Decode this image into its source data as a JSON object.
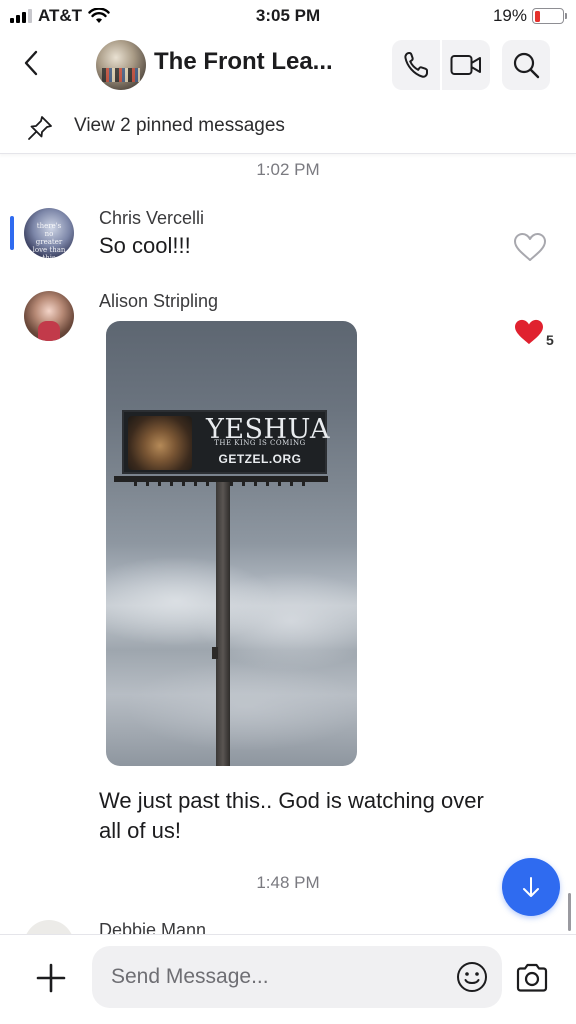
{
  "status_bar": {
    "carrier": "AT&T",
    "time": "3:05 PM",
    "battery_percent": "19%",
    "battery_level": 0.19,
    "icons": [
      "signal-icon",
      "wifi-icon",
      "battery-icon"
    ]
  },
  "header": {
    "title": "The Front Lea...",
    "back_icon": "chevron-left-icon",
    "call_icon": "phone-icon",
    "video_icon": "video-camera-icon",
    "search_icon": "search-icon"
  },
  "pinned": {
    "label": "View 2 pinned messages",
    "icon": "pin-icon"
  },
  "messages": [
    {
      "timestamp": "1:02 PM",
      "sender": "Chris Vercelli",
      "text": "So cool!!!",
      "avatar_text": "there's no greater love than this",
      "liked": false
    },
    {
      "sender": "Alison Stripling",
      "text": "We just past this.. God is watching over all of us!",
      "liked": true,
      "like_count": "5",
      "like_color": "#e0212f",
      "photo": {
        "billboard_title": "YESHUA",
        "billboard_subtitle": "THE KING IS COMING",
        "billboard_url": "GETZEL.ORG"
      }
    },
    {
      "timestamp": "1:48 PM",
      "sender": "Debbie Mann"
    }
  ],
  "composer": {
    "placeholder": "Send Message...",
    "add_icon": "plus-icon",
    "emoji_icon": "emoji-icon",
    "camera_icon": "camera-icon"
  },
  "colors": {
    "accent": "#2f6bf0",
    "heart": "#e0212f",
    "battery_low": "#e5322d"
  }
}
